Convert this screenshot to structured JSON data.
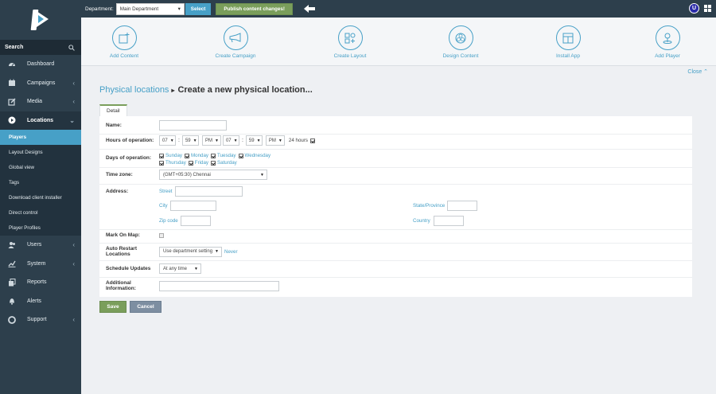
{
  "topbar": {
    "department_label": "Department:",
    "department_value": "Main Department",
    "select_label": "Select",
    "publish_label": "Publish content changes!",
    "user_initial": "U"
  },
  "sidebar": {
    "search_label": "Search",
    "items": [
      {
        "label": "Dashboard",
        "icon": "dashboard-icon"
      },
      {
        "label": "Campaigns",
        "icon": "calendar-icon"
      },
      {
        "label": "Media",
        "icon": "edit-icon"
      },
      {
        "label": "Locations",
        "icon": "play-circle-icon"
      }
    ],
    "sub_items": [
      {
        "label": "Players"
      },
      {
        "label": "Layout Designs"
      },
      {
        "label": "Global view"
      },
      {
        "label": "Tags"
      },
      {
        "label": "Download client installer"
      },
      {
        "label": "Direct control"
      },
      {
        "label": "Player Profiles"
      }
    ],
    "items_after": [
      {
        "label": "Users",
        "icon": "users-icon"
      },
      {
        "label": "System",
        "icon": "chart-icon"
      },
      {
        "label": "Reports",
        "icon": "copy-icon"
      },
      {
        "label": "Alerts",
        "icon": "bell-icon"
      },
      {
        "label": "Support",
        "icon": "lifebuoy-icon"
      }
    ]
  },
  "quick_actions": [
    {
      "label": "Add Content"
    },
    {
      "label": "Create Campaign"
    },
    {
      "label": "Create Layout"
    },
    {
      "label": "Design Content"
    },
    {
      "label": "Install App"
    },
    {
      "label": "Add Player"
    }
  ],
  "close_label": "Close",
  "breadcrumb": {
    "parent": "Physical locations",
    "current": "Create a new physical location..."
  },
  "tab_label": "Detail",
  "form": {
    "name_label": "Name:",
    "name_value": "",
    "hours_label": "Hours of operation:",
    "hours": {
      "start_hour": "07",
      "start_min": "59",
      "start_ampm": "PM",
      "end_hour": "07",
      "end_min": "59",
      "end_ampm": "PM",
      "all_day_label": "24 hours",
      "all_day_checked": true
    },
    "days_label": "Days of operation:",
    "days": [
      {
        "label": "Sunday",
        "checked": true
      },
      {
        "label": "Monday",
        "checked": true
      },
      {
        "label": "Tuesday",
        "checked": true
      },
      {
        "label": "Wednesday",
        "checked": true
      },
      {
        "label": "Thursday",
        "checked": true
      },
      {
        "label": "Friday",
        "checked": true
      },
      {
        "label": "Saturday",
        "checked": true
      }
    ],
    "timezone_label": "Time zone:",
    "timezone_value": "(GMT+05:30) Chennai",
    "address_label": "Address:",
    "street_label": "Street",
    "city_label": "City",
    "state_label": "State/Province",
    "zip_label": "Zip code",
    "country_label": "Country",
    "mark_on_map_label": "Mark On Map:",
    "auto_restart_label": "Auto Restart Locations",
    "auto_restart_value": "Use department setting",
    "auto_restart_note": "Never",
    "schedule_label": "Schedule Updates",
    "schedule_value": "At any time",
    "additional_label": "Additional Information:"
  },
  "buttons": {
    "save": "Save",
    "cancel": "Cancel"
  },
  "colors": {
    "sidebar": "#2d3f4c",
    "accent": "#47a0c7",
    "green": "#7a9e5b"
  }
}
